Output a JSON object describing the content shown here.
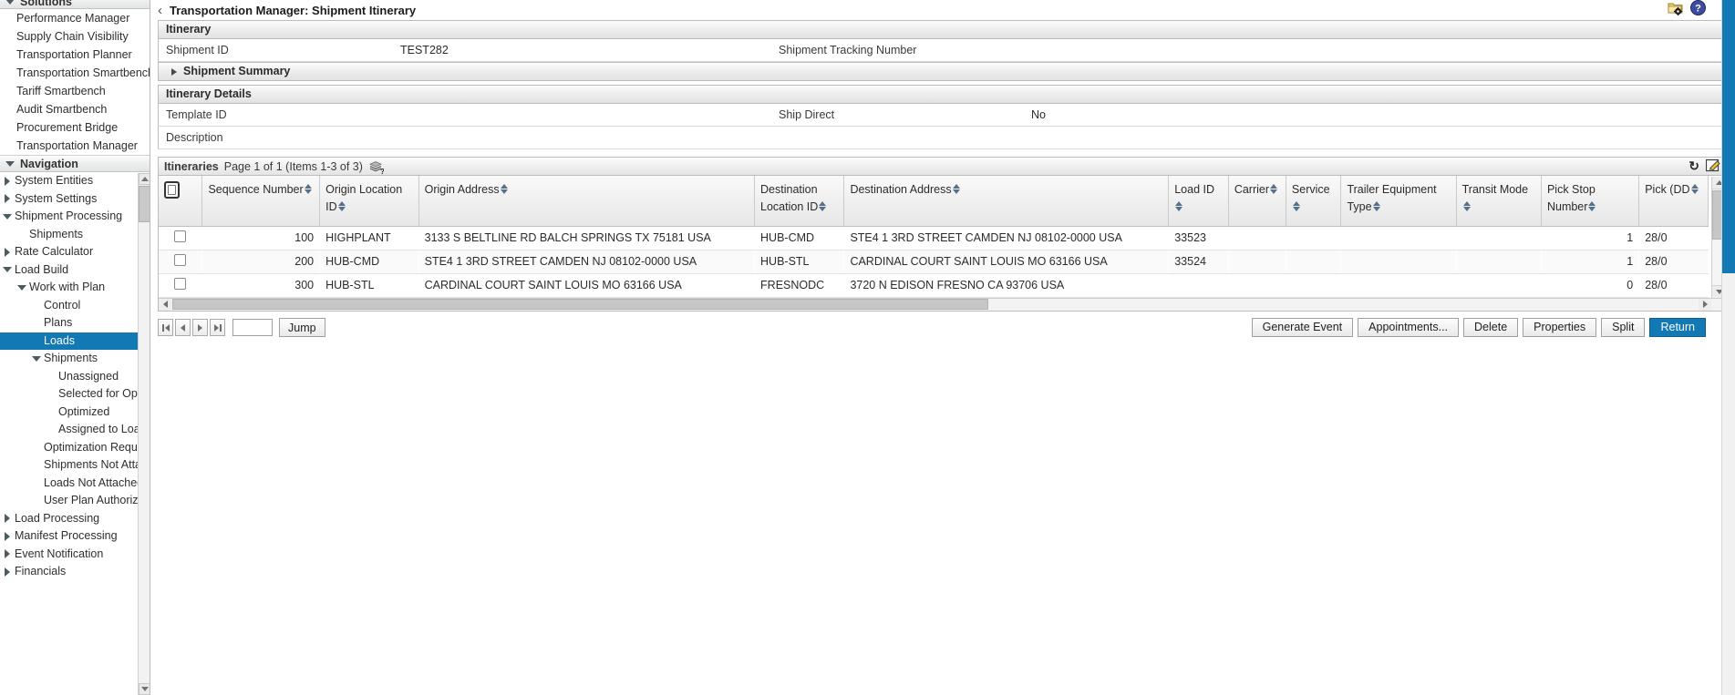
{
  "sidebar": {
    "solutions": {
      "title": "Solutions",
      "items": [
        {
          "label": "Performance Manager"
        },
        {
          "label": "Supply Chain Visibility"
        },
        {
          "label": "Transportation Planner"
        },
        {
          "label": "Transportation Smartbench"
        },
        {
          "label": "Tariff Smartbench"
        },
        {
          "label": "Audit Smartbench"
        },
        {
          "label": "Procurement Bridge"
        },
        {
          "label": "Transportation Manager"
        }
      ]
    },
    "navigation": {
      "title": "Navigation",
      "items": [
        {
          "label": "System Entities",
          "indent": 0,
          "state": "collapsed",
          "selected": false
        },
        {
          "label": "System Settings",
          "indent": 0,
          "state": "collapsed",
          "selected": false
        },
        {
          "label": "Shipment Processing",
          "indent": 0,
          "state": "expanded",
          "selected": false
        },
        {
          "label": "Shipments",
          "indent": 1,
          "state": "leaf",
          "selected": false
        },
        {
          "label": "Rate Calculator",
          "indent": 0,
          "state": "collapsed",
          "selected": false
        },
        {
          "label": "Load Build",
          "indent": 0,
          "state": "expanded",
          "selected": false
        },
        {
          "label": "Work with Plan",
          "indent": 1,
          "state": "expanded",
          "selected": false
        },
        {
          "label": "Control",
          "indent": 2,
          "state": "leaf",
          "selected": false
        },
        {
          "label": "Plans",
          "indent": 2,
          "state": "leaf",
          "selected": false
        },
        {
          "label": "Loads",
          "indent": 2,
          "state": "leaf",
          "selected": true
        },
        {
          "label": "Shipments",
          "indent": 2,
          "state": "expanded",
          "selected": false
        },
        {
          "label": "Unassigned",
          "indent": 3,
          "state": "leaf",
          "selected": false
        },
        {
          "label": "Selected for Optimiza",
          "indent": 3,
          "state": "leaf",
          "selected": false
        },
        {
          "label": "Optimized",
          "indent": 3,
          "state": "leaf",
          "selected": false
        },
        {
          "label": "Assigned to Load",
          "indent": 3,
          "state": "leaf",
          "selected": false
        },
        {
          "label": "Optimization Requests",
          "indent": 2,
          "state": "leaf",
          "selected": false
        },
        {
          "label": "Shipments Not Attached",
          "indent": 2,
          "state": "leaf",
          "selected": false
        },
        {
          "label": "Loads Not Attached",
          "indent": 2,
          "state": "leaf",
          "selected": false
        },
        {
          "label": "User Plan Authorization",
          "indent": 2,
          "state": "leaf",
          "selected": false
        },
        {
          "label": "Load Processing",
          "indent": 0,
          "state": "collapsed",
          "selected": false
        },
        {
          "label": "Manifest Processing",
          "indent": 0,
          "state": "collapsed",
          "selected": false
        },
        {
          "label": "Event Notification",
          "indent": 0,
          "state": "collapsed",
          "selected": false
        },
        {
          "label": "Financials",
          "indent": 0,
          "state": "collapsed",
          "selected": false
        }
      ]
    }
  },
  "header": {
    "back_label": "‹",
    "title": "Transportation Manager: Shipment Itinerary",
    "settings_icon": "folder-gear-icon",
    "help_icon": "help-icon"
  },
  "itinerary_panel": {
    "title": "Itinerary",
    "shipment_id_label": "Shipment ID",
    "shipment_id_value": "TEST282",
    "tracking_label": "Shipment Tracking Number",
    "tracking_value": ""
  },
  "shipment_summary": {
    "title": "Shipment Summary",
    "expanded": false
  },
  "itinerary_details": {
    "title": "Itinerary Details",
    "template_id_label": "Template ID",
    "template_id_value": "",
    "ship_direct_label": "Ship Direct",
    "ship_direct_value": "No",
    "description_label": "Description",
    "description_value": ""
  },
  "grid": {
    "caption_title": "Itineraries",
    "caption_paging": "Page 1 of 1 (Items 1-3 of 3)",
    "stack_icon": "layers-help-icon",
    "refresh_icon": "refresh-icon",
    "export_icon": "edit-export-icon",
    "select_all_checkbox": "select-all-checkbox",
    "columns": [
      {
        "label": "Sequence Number",
        "sortable": true,
        "align": "num"
      },
      {
        "label": "Origin Location ID",
        "sortable": true,
        "align": "text"
      },
      {
        "label": "Origin Address",
        "sortable": true,
        "align": "text"
      },
      {
        "label": "Destination Location ID",
        "sortable": true,
        "align": "text"
      },
      {
        "label": "Destination Address",
        "sortable": true,
        "align": "text"
      },
      {
        "label": "Load ID",
        "sortable": true,
        "align": "text"
      },
      {
        "label": "Carrier",
        "sortable": true,
        "align": "text"
      },
      {
        "label": "Service",
        "sortable": true,
        "align": "text"
      },
      {
        "label": "Trailer Equipment Type",
        "sortable": true,
        "align": "text"
      },
      {
        "label": "Transit Mode",
        "sortable": true,
        "align": "text"
      },
      {
        "label": "Pick Stop Number",
        "sortable": true,
        "align": "num"
      },
      {
        "label": "Pick (DD",
        "sortable": true,
        "align": "text"
      }
    ],
    "rows": [
      {
        "sequence_number": "100",
        "origin_location_id": "HIGHPLANT",
        "origin_address": "3133 S BELTLINE RD BALCH SPRINGS TX 75181 USA",
        "destination_location_id": "HUB-CMD",
        "destination_address": "STE4 1 3RD STREET CAMDEN NJ 08102-0000 USA",
        "load_id": "33523",
        "carrier": "",
        "service": "",
        "trailer_equipment_type": "",
        "transit_mode": "",
        "pick_stop_number": "1",
        "pick_date": "28/0"
      },
      {
        "sequence_number": "200",
        "origin_location_id": "HUB-CMD",
        "origin_address": "STE4 1 3RD STREET CAMDEN NJ 08102-0000 USA",
        "destination_location_id": "HUB-STL",
        "destination_address": "CARDINAL COURT SAINT LOUIS MO 63166 USA",
        "load_id": "33524",
        "carrier": "",
        "service": "",
        "trailer_equipment_type": "",
        "transit_mode": "",
        "pick_stop_number": "1",
        "pick_date": "28/0"
      },
      {
        "sequence_number": "300",
        "origin_location_id": "HUB-STL",
        "origin_address": "CARDINAL COURT SAINT LOUIS MO 63166 USA",
        "destination_location_id": "FRESNODC",
        "destination_address": "3720 N EDISON FRESNO CA 93706 USA",
        "load_id": "",
        "carrier": "",
        "service": "",
        "trailer_equipment_type": "",
        "transit_mode": "",
        "pick_stop_number": "0",
        "pick_date": "28/0"
      }
    ]
  },
  "footer": {
    "first_page_icon": "first-page-icon",
    "prev_page_icon": "prev-page-icon",
    "next_page_icon": "next-page-icon",
    "last_page_icon": "last-page-icon",
    "jump_value": "",
    "jump_label": "Jump",
    "buttons": [
      {
        "label": "Generate Event",
        "primary": false
      },
      {
        "label": "Appointments...",
        "primary": false
      },
      {
        "label": "Delete",
        "primary": false
      },
      {
        "label": "Properties",
        "primary": false
      },
      {
        "label": "Split",
        "primary": false
      },
      {
        "label": "Return",
        "primary": true
      }
    ]
  },
  "colors": {
    "accent": "#1279b4",
    "panel_border": "#bcbcbc",
    "sort_arrow": "#55708a"
  }
}
